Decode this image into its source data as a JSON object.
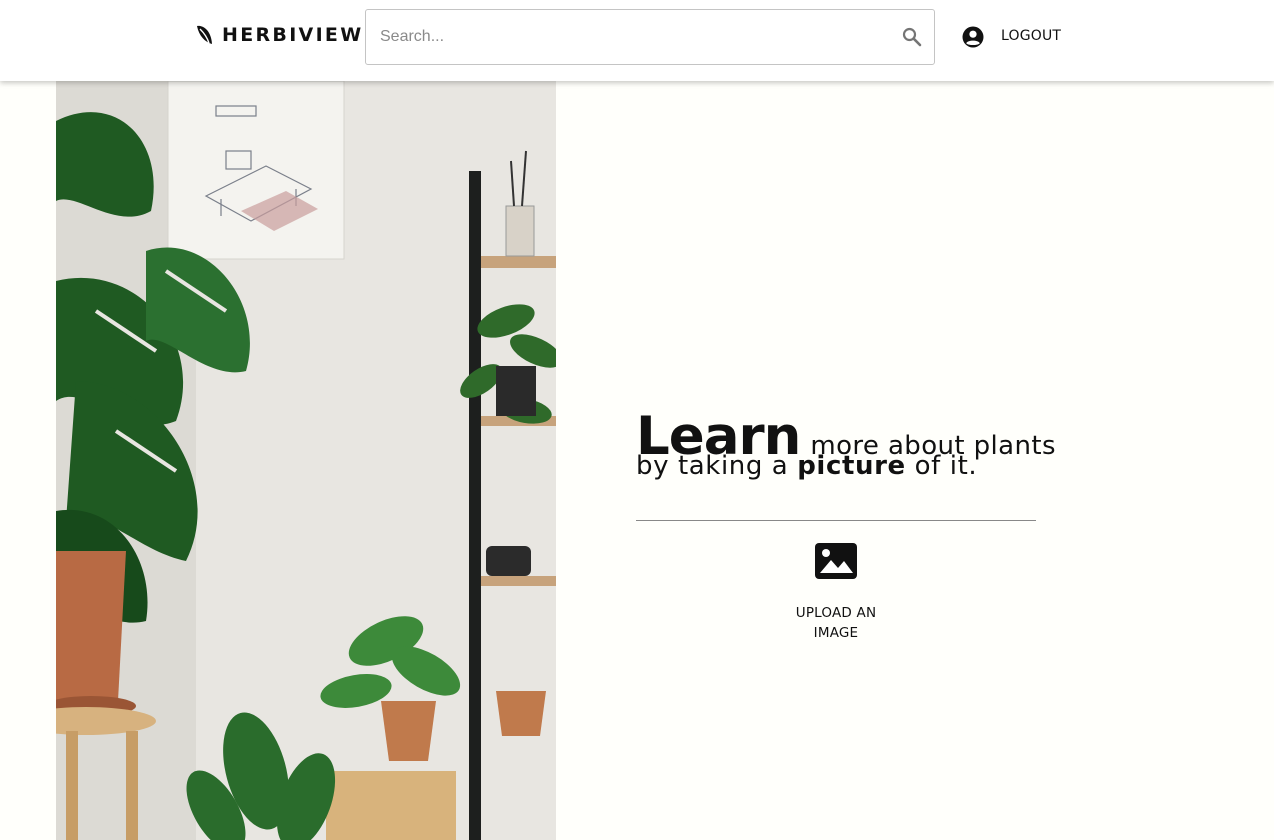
{
  "header": {
    "brand": "HERBIVIEW",
    "search": {
      "placeholder": "Search...",
      "value": ""
    },
    "logout_label": "LOGOUT"
  },
  "hero": {
    "headline_big": "Learn",
    "headline_rest": "more about plants",
    "line2_prefix": "by taking a ",
    "line2_bold": "picture",
    "line2_suffix": " of it."
  },
  "upload": {
    "label_line1": "UPLOAD AN",
    "label_line2": "IMAGE"
  },
  "icons": {
    "logo": "leaf-icon",
    "search": "search-icon",
    "account": "account-circle-icon",
    "upload": "image-icon"
  },
  "colors": {
    "text": "#111111",
    "page_background": "#fffffb",
    "header_background": "#ffffff"
  }
}
